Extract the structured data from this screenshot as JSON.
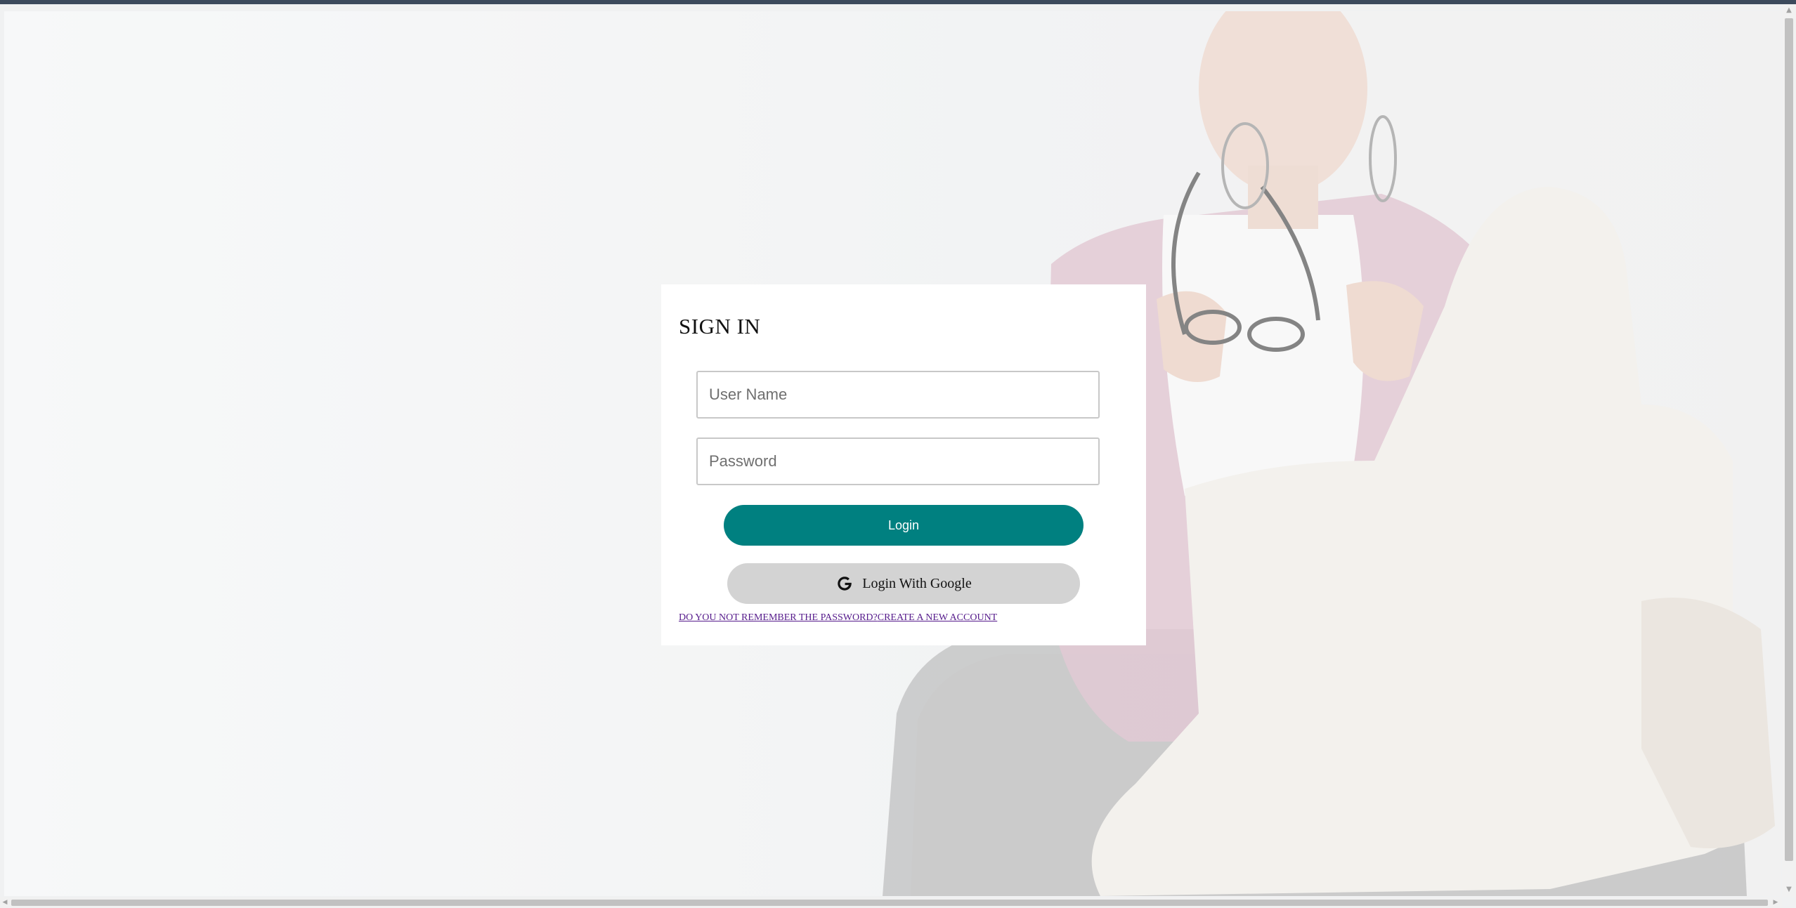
{
  "signin": {
    "title": "SIGN IN",
    "username_placeholder": "User Name",
    "password_placeholder": "Password",
    "login_label": "Login",
    "google_label": "Login With Google",
    "forgot_link": "DO YOU NOT REMEMBER THE PASSWORD?",
    "create_link": "CREATE A NEW ACCOUNT"
  },
  "icons": {
    "google": "google-g-icon"
  },
  "colors": {
    "login_button": "#008080",
    "google_button": "#d3d3d3",
    "link": "#551a8b"
  }
}
